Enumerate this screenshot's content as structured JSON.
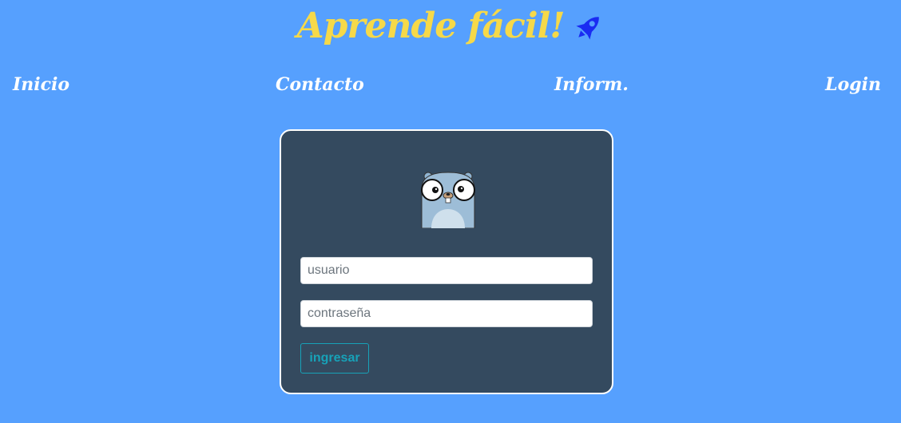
{
  "header": {
    "title": "Aprende fácil!",
    "icon": "rocket-icon",
    "title_color": "#f6d949",
    "icon_color": "#1a2bf2"
  },
  "nav": {
    "items": [
      {
        "label": "Inicio"
      },
      {
        "label": "Contacto"
      },
      {
        "label": "Inform."
      },
      {
        "label": "Login"
      }
    ]
  },
  "login": {
    "logo": "gopher-mascot",
    "username_placeholder": "usuario",
    "password_placeholder": "contraseña",
    "submit_label": "ingresar",
    "card_color": "#344a5f",
    "button_color": "#17a2b8"
  },
  "colors": {
    "page_background": "#56a0fe"
  }
}
